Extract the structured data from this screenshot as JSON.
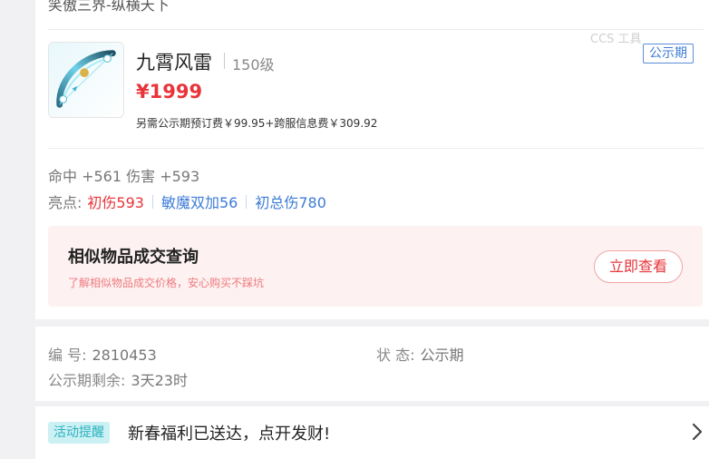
{
  "top_text": "笑傲三界-纵横天下",
  "watermark": "CCS 工具",
  "item": {
    "name": "九霄风雷",
    "level": "150级",
    "price": "¥1999",
    "fee_text": "另需公示期预订费￥99.95+跨服信息费￥309.92",
    "status_badge": "公示期",
    "icon": "bow-icon"
  },
  "stats": {
    "text": "命中 +561 伤害 +593"
  },
  "highlights": {
    "label": "亮点:",
    "items": [
      "初伤593",
      "敏魔双加56",
      "初总伤780"
    ]
  },
  "similar_query": {
    "title": "相似物品成交查询",
    "subtitle": "了解相似物品成交价格，安心购买不踩坑",
    "button_label": "立即查看"
  },
  "meta": {
    "id_label": "编 号:",
    "id_value": "2810453",
    "status_label": "状 态:",
    "status_value": "公示期",
    "remaining_label": "公示期剩余:",
    "remaining_value": "3天23时"
  },
  "notice": {
    "badge": "活动提醒",
    "text": "新春福利已送达，点开发财!",
    "icon": "chevron-right-icon"
  },
  "colors": {
    "price_red": "#e8343a",
    "link_blue": "#3d7bd6",
    "query_bg": "#fdf1f1",
    "notice_badge_bg": "#ccf1f4"
  }
}
